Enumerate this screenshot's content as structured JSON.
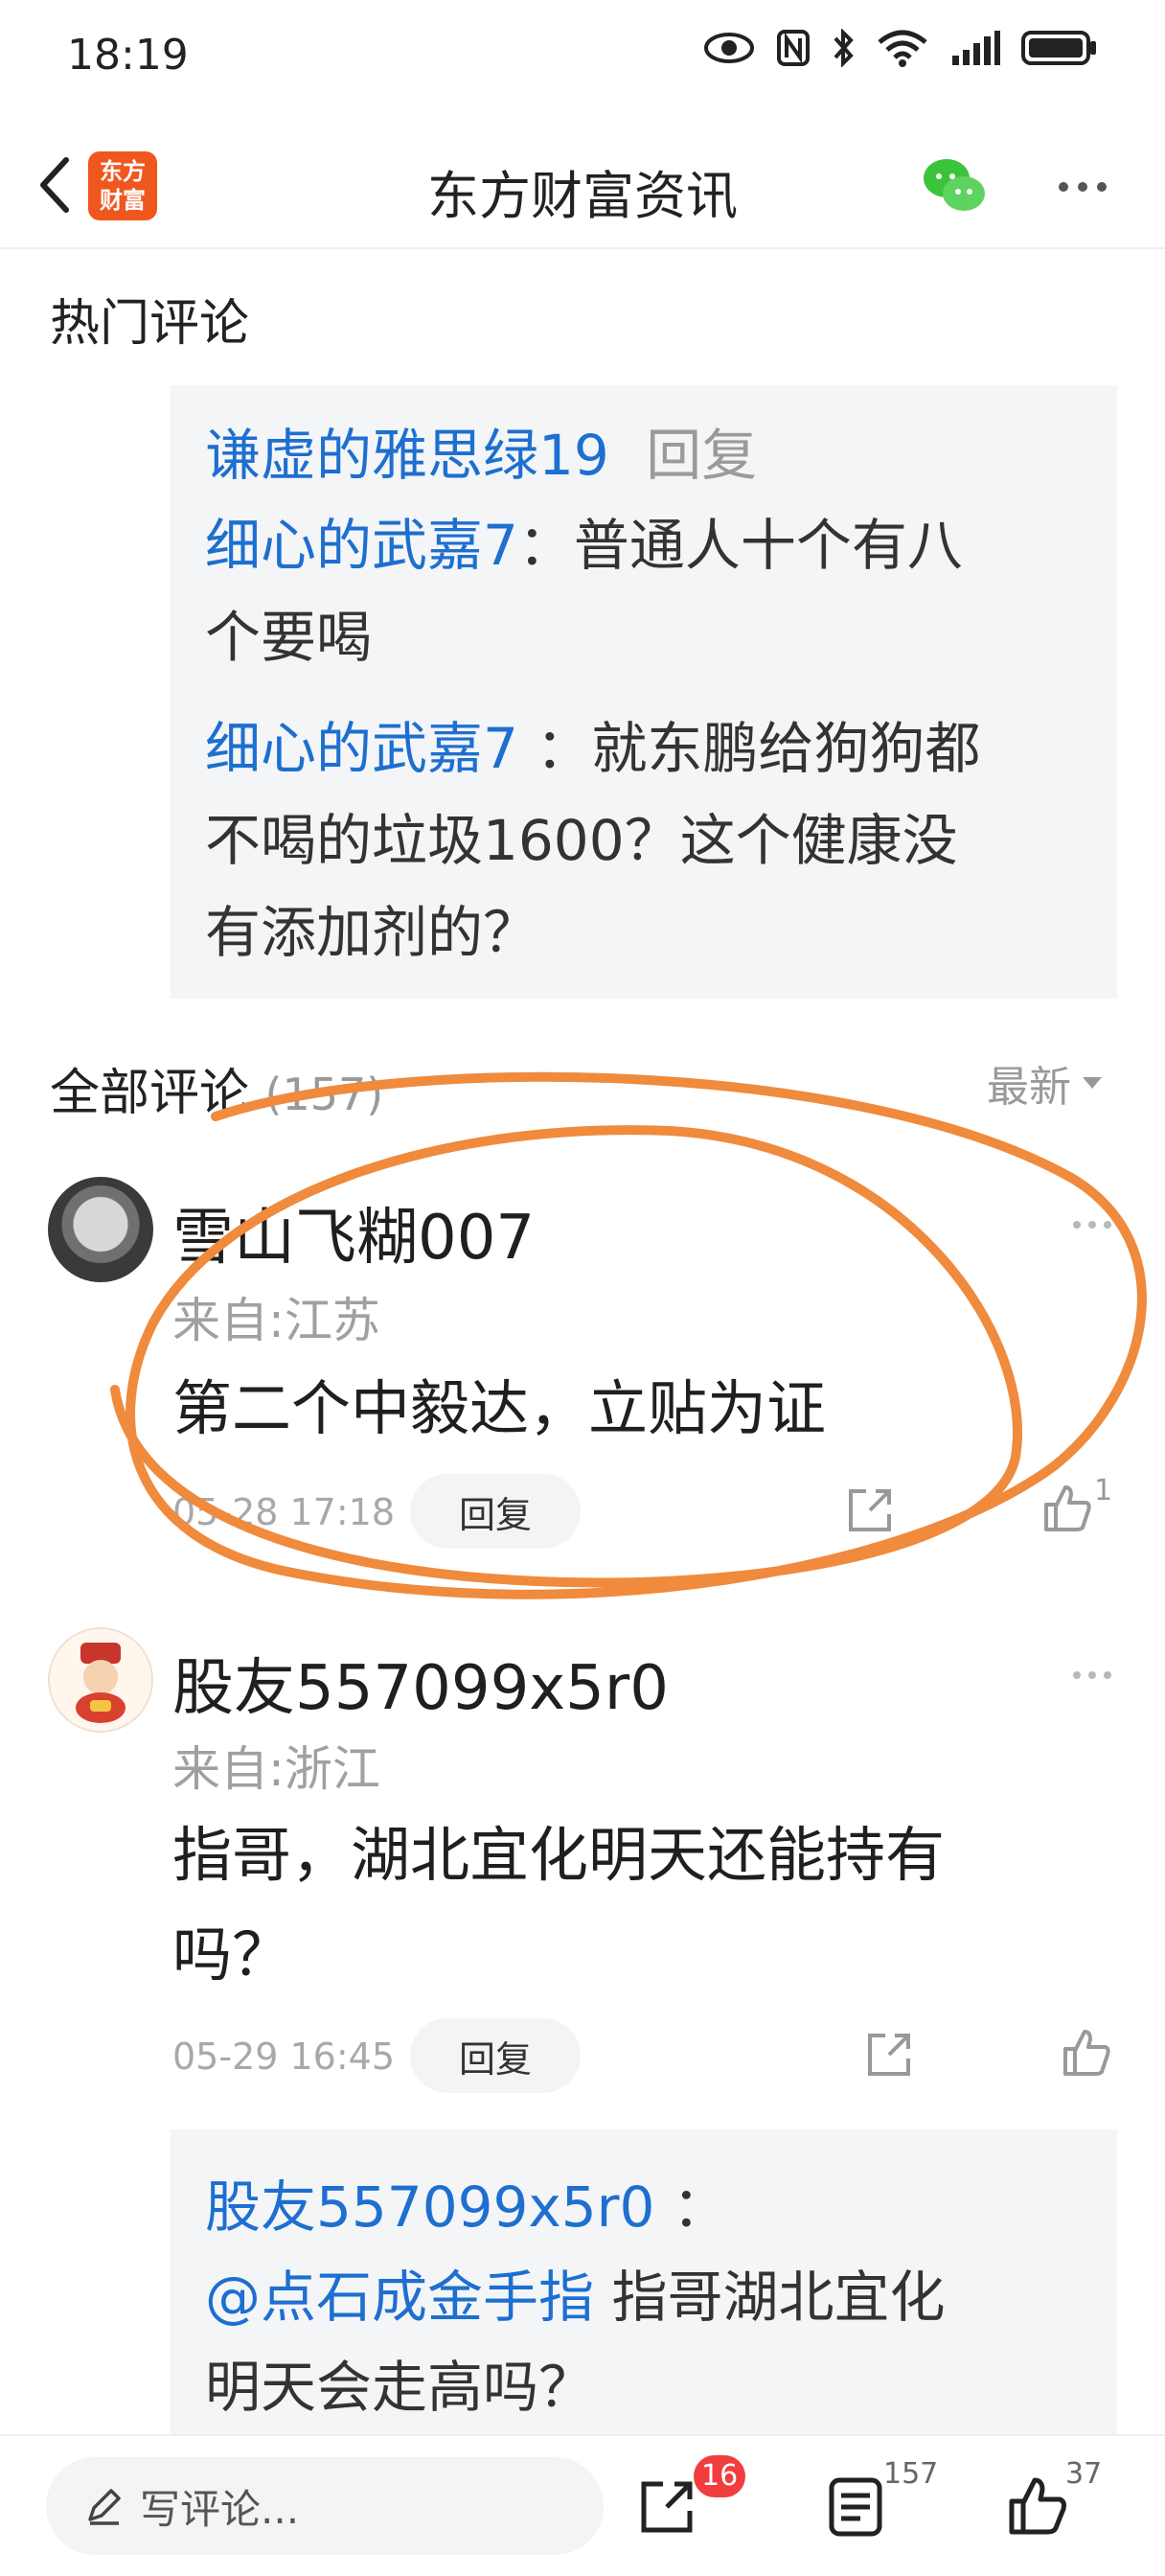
{
  "status_bar": {
    "time": "18:19"
  },
  "nav": {
    "title": "东方财富资讯",
    "logo_text": "东方财富"
  },
  "hot_comments": {
    "title": "热门评论",
    "reply_header_user": "谦虚的雅思绿19",
    "reply_header_action": "回复",
    "lines": [
      {
        "user": "细心的武嘉7",
        "sep": "：",
        "text": "普通人十个有八",
        "cont": "个要喝"
      },
      {
        "user": "细心的武嘉7",
        "sep": " ：",
        "text": "就东鹏给狗狗都",
        "cont1": "不喝的垃圾1600？这个健康没",
        "cont2": "有添加剂的？"
      }
    ]
  },
  "all_comments": {
    "title": "全部评论",
    "count": "(157)",
    "sort_label": "最新"
  },
  "comments": [
    {
      "name": "雪山飞糊007",
      "location": "来自:江苏",
      "text": "第二个中毅达，立贴为证",
      "time": "05-28 17:18",
      "reply_label": "回复",
      "likes": "1"
    },
    {
      "name": "股友557099x5r0",
      "location": "来自:浙江",
      "text_line1": "指哥，湖北宜化明天还能持有",
      "text_line2": "吗？",
      "time": "05-29 16:45",
      "reply_label": "回复",
      "sub_reply": {
        "user": "股友557099x5r0",
        "sep": " ：",
        "mention": "@点石成金手指",
        "text": " 指哥湖北宜化",
        "cont": "明天会走高吗？"
      }
    }
  ],
  "bottom_bar": {
    "input_placeholder": "写评论...",
    "share_badge": "16",
    "comment_count": "157",
    "like_count": "37"
  },
  "colors": {
    "link_blue": "#1d6fd0",
    "annotation_orange": "#f08a3c",
    "badge_red": "#f03e3e",
    "brand_orange": "#f0571f"
  }
}
